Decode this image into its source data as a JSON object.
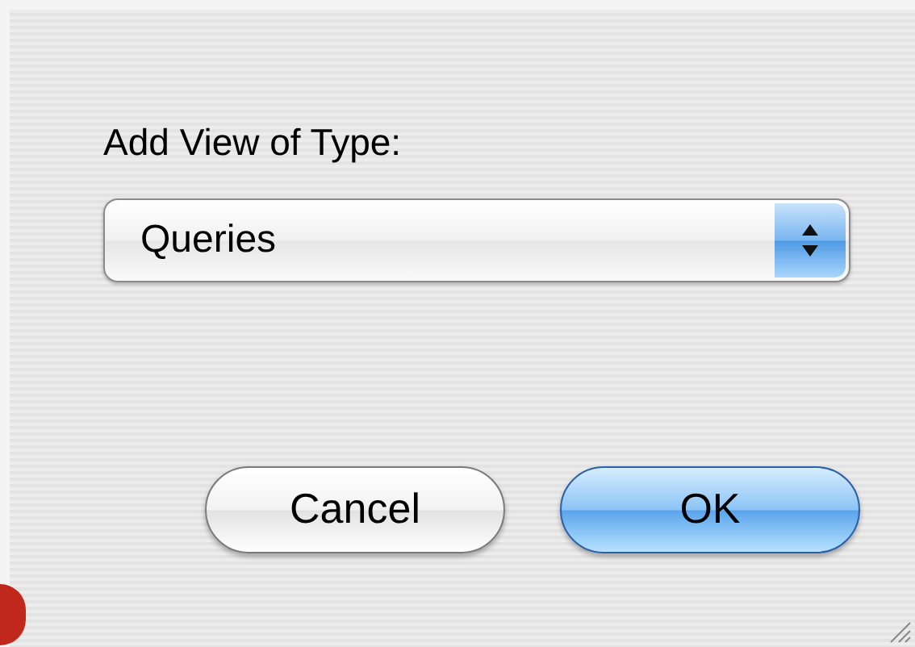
{
  "dialog": {
    "label": "Add View of Type:",
    "popup": {
      "value": "Queries"
    },
    "buttons": [
      {
        "label": "Cancel",
        "kind": "normal"
      },
      {
        "label": "OK",
        "kind": "default"
      }
    ]
  }
}
